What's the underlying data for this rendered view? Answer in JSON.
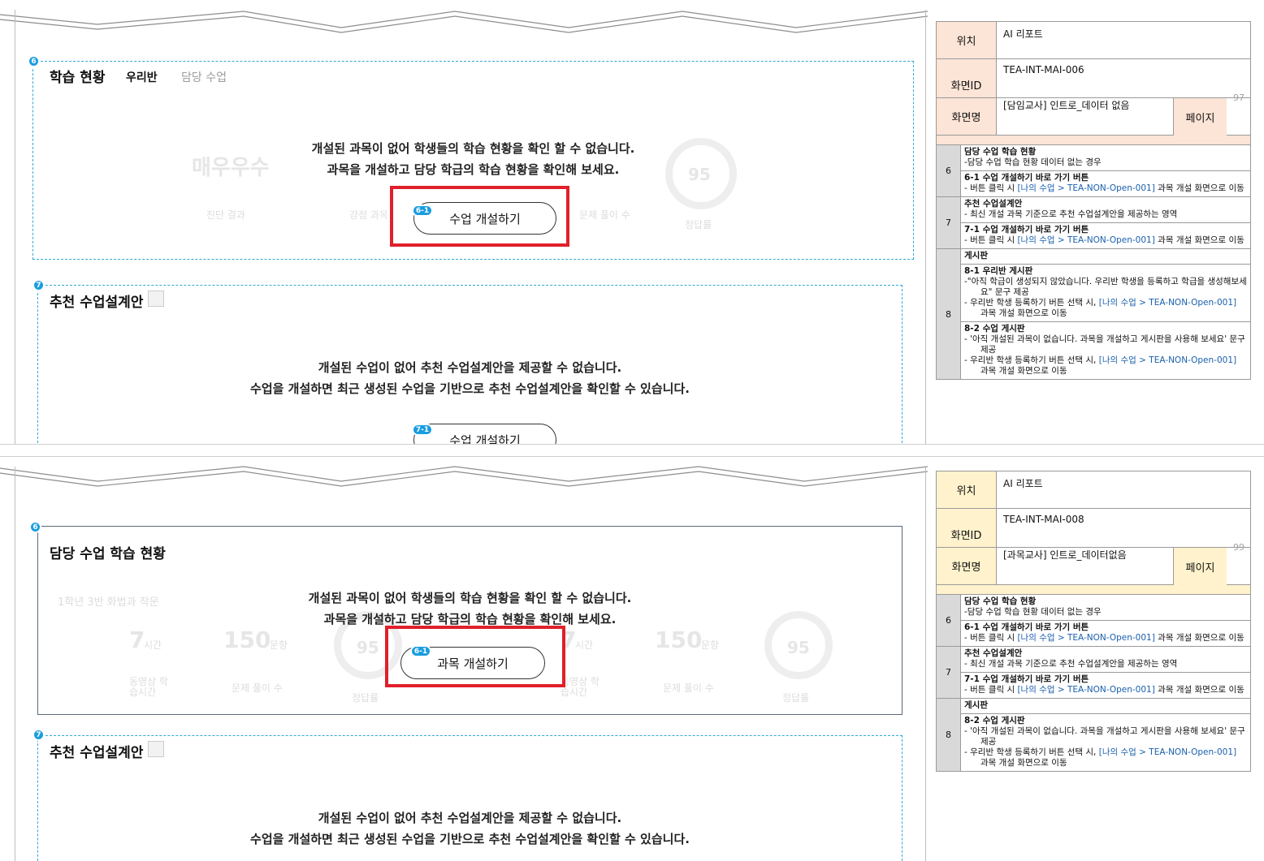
{
  "colors": {
    "accent": "#1a9de0",
    "highlight": "#e0202a",
    "header_p1": "#fce4d6",
    "header_p2": "#fff2cc",
    "link": "#1a5fae"
  },
  "page1": {
    "section6": {
      "badge": "6",
      "title": "학습 현황",
      "tab_active": "우리반",
      "tab_inactive": "담당 수업",
      "msg_line1": "개설된 과목이 없어 학생들의 학습 현황을 확인 할 수 없습니다.",
      "msg_line2": "과목을 개설하고 담당 학급의 학습 현황을 확인해 보세요.",
      "ghost_grade": "매우우수",
      "ghost_label1": "진단 결과",
      "ghost_label2": "강점 과목",
      "ghost_label3": "문제 풀이 수",
      "ghost_pct": "95",
      "ghost_pct_label": "정답률",
      "button_badge": "6-1",
      "button_label": "수업 개설하기"
    },
    "section7": {
      "badge": "7",
      "title": "추천 수업설계안",
      "msg_line1": "개설된 수업이 없어 추천 수업설계안을 제공할 수 없습니다.",
      "msg_line2": "수업을 개설하면 최근 생성된 수업을 기반으로 추천 수업설계안을 확인할 수 있습니다.",
      "button_badge": "7-1",
      "button_label": "수업 개설하기"
    },
    "spec": {
      "location_label": "위치",
      "location_value": "AI 리포트",
      "screen_id_label": "화면ID",
      "screen_id_value": "TEA-INT-MAI-006",
      "screen_name_label": "화면명",
      "screen_name_value": "[담임교사] 인트로_데이터 없음",
      "page_label": "페이지",
      "page_number": "97"
    },
    "desc": [
      {
        "num": "6",
        "items": [
          {
            "title": "담당 수업 학습  현황",
            "lines": [
              "-담당 수업 학습 현황 데이터 없는 경우"
            ]
          },
          {
            "title": "6-1 수업 개설하기 바로 가기 버튼",
            "pre": "-    버튼 클릭 시 ",
            "link": "[나의 수업 > TEA-NON-Open-001]",
            "post": " 과목 개설 화면으로 이동"
          }
        ]
      },
      {
        "num": "7",
        "items": [
          {
            "title": "추천 수업설계안",
            "lines": [
              "-    최신 개설 과목 기준으로 추천 수업설계안을 제공하는 영역"
            ]
          },
          {
            "title": "7-1 수업 개설하기 바로 가기 버튼",
            "pre": "-    버튼 클릭 시 ",
            "link": "[나의 수업 > TEA-NON-Open-001]",
            "post": " 과목 개설 화면으로 이동"
          }
        ]
      },
      {
        "num": "8",
        "items": [
          {
            "title": "게시판",
            "lines": []
          },
          {
            "title": "8-1 우리반 게시판",
            "lines": [
              "-\"아직 학급이 생성되지 않았습니다. 우리반 학생을 등록하고 학급을 생성해보세요\" 문구 제공"
            ],
            "pre": "- 우리반 학생 등록하기 버튼 선택 시, ",
            "link": "[나의 수업 > TEA-NON-Open-001]",
            "post": " 과목 개설 화면으로 이동"
          },
          {
            "title": "8-2 수업 게시판",
            "lines": [
              "-    '아직 개설된 과목이 없습니다.  과목을 개설하고 게시판을 사용해 보세요' 문구 제공"
            ],
            "pre": "-    우리반 학생 등록하기 버튼 선택 시, ",
            "link": "[나의 수업 > TEA-NON-Open-001]",
            "post": " 과목 개설 화면으로 이동"
          }
        ]
      }
    ]
  },
  "page2": {
    "section6": {
      "badge": "6",
      "title": "담당 수업 학습 현황",
      "msg_line1": "개설된 과목이 없어 학생들의 학습 현황을 확인 할 수 없습니다.",
      "msg_line2": "과목을 개설하고 담당 학급의 학습 현황을 확인해 보세요.",
      "ghost_class": "1학년 3반 화법과 작문",
      "ghost_hours": "7",
      "ghost_hours_unit": "시간",
      "ghost_count": "150",
      "ghost_count_unit": "문항",
      "ghost_pct": "95",
      "ghost_label_video": "동영상 학습시간",
      "ghost_label_solve": "문제 풀이 수",
      "ghost_label_rate": "정답률",
      "button_badge": "6-1",
      "button_label": "과목 개설하기"
    },
    "section7": {
      "badge": "7",
      "title": "추천 수업설계안",
      "msg_line1": "개설된 수업이 없어 추천 수업설계안을 제공할 수 없습니다.",
      "msg_line2": "수업을 개설하면 최근 생성된 수업을 기반으로 추천 수업설계안을 확인할 수 있습니다."
    },
    "spec": {
      "location_label": "위치",
      "location_value": "AI 리포트",
      "screen_id_label": "화면ID",
      "screen_id_value": "TEA-INT-MAI-008",
      "screen_name_label": "화면명",
      "screen_name_value": "[과목교사] 인트로_데이터없음",
      "page_label": "페이지",
      "page_number": "99"
    },
    "desc": [
      {
        "num": "6",
        "items": [
          {
            "title": "담당 수업 학습  현황",
            "lines": [
              "-담당 수업 학습 현황 데이터 없는 경우"
            ]
          },
          {
            "title": "6-1 수업 개설하기 바로 가기 버튼",
            "pre": "-    버튼 클릭 시 ",
            "link": "[나의 수업 > TEA-NON-Open-001]",
            "post": " 과목 개설 화면으로 이동"
          }
        ]
      },
      {
        "num": "7",
        "items": [
          {
            "title": "추천 수업설계안",
            "lines": [
              "-    최신 개설 과목 기준으로 추천 수업설계안을 제공하는 영역"
            ]
          },
          {
            "title": "7-1 수업 개설하기 바로 가기 버튼",
            "pre": "-    버튼 클릭 시 ",
            "link": "[나의 수업 > TEA-NON-Open-001]",
            "post": " 과목 개설 화면으로 이동"
          }
        ]
      },
      {
        "num": "8",
        "items": [
          {
            "title": "게시판",
            "lines": []
          },
          {
            "title": "8-2 수업 게시판",
            "lines": [
              "-    '아직 개설된 과목이 없습니다.  과목을 개설하고 게시판을 사용해 보세요' 문구 제공"
            ],
            "pre": "-    우리반 학생 등록하기 버튼 선택 시, ",
            "link": "[나의 수업 > TEA-NON-Open-001]",
            "post": " 과목 개설 화면으로 이동"
          }
        ]
      }
    ]
  }
}
